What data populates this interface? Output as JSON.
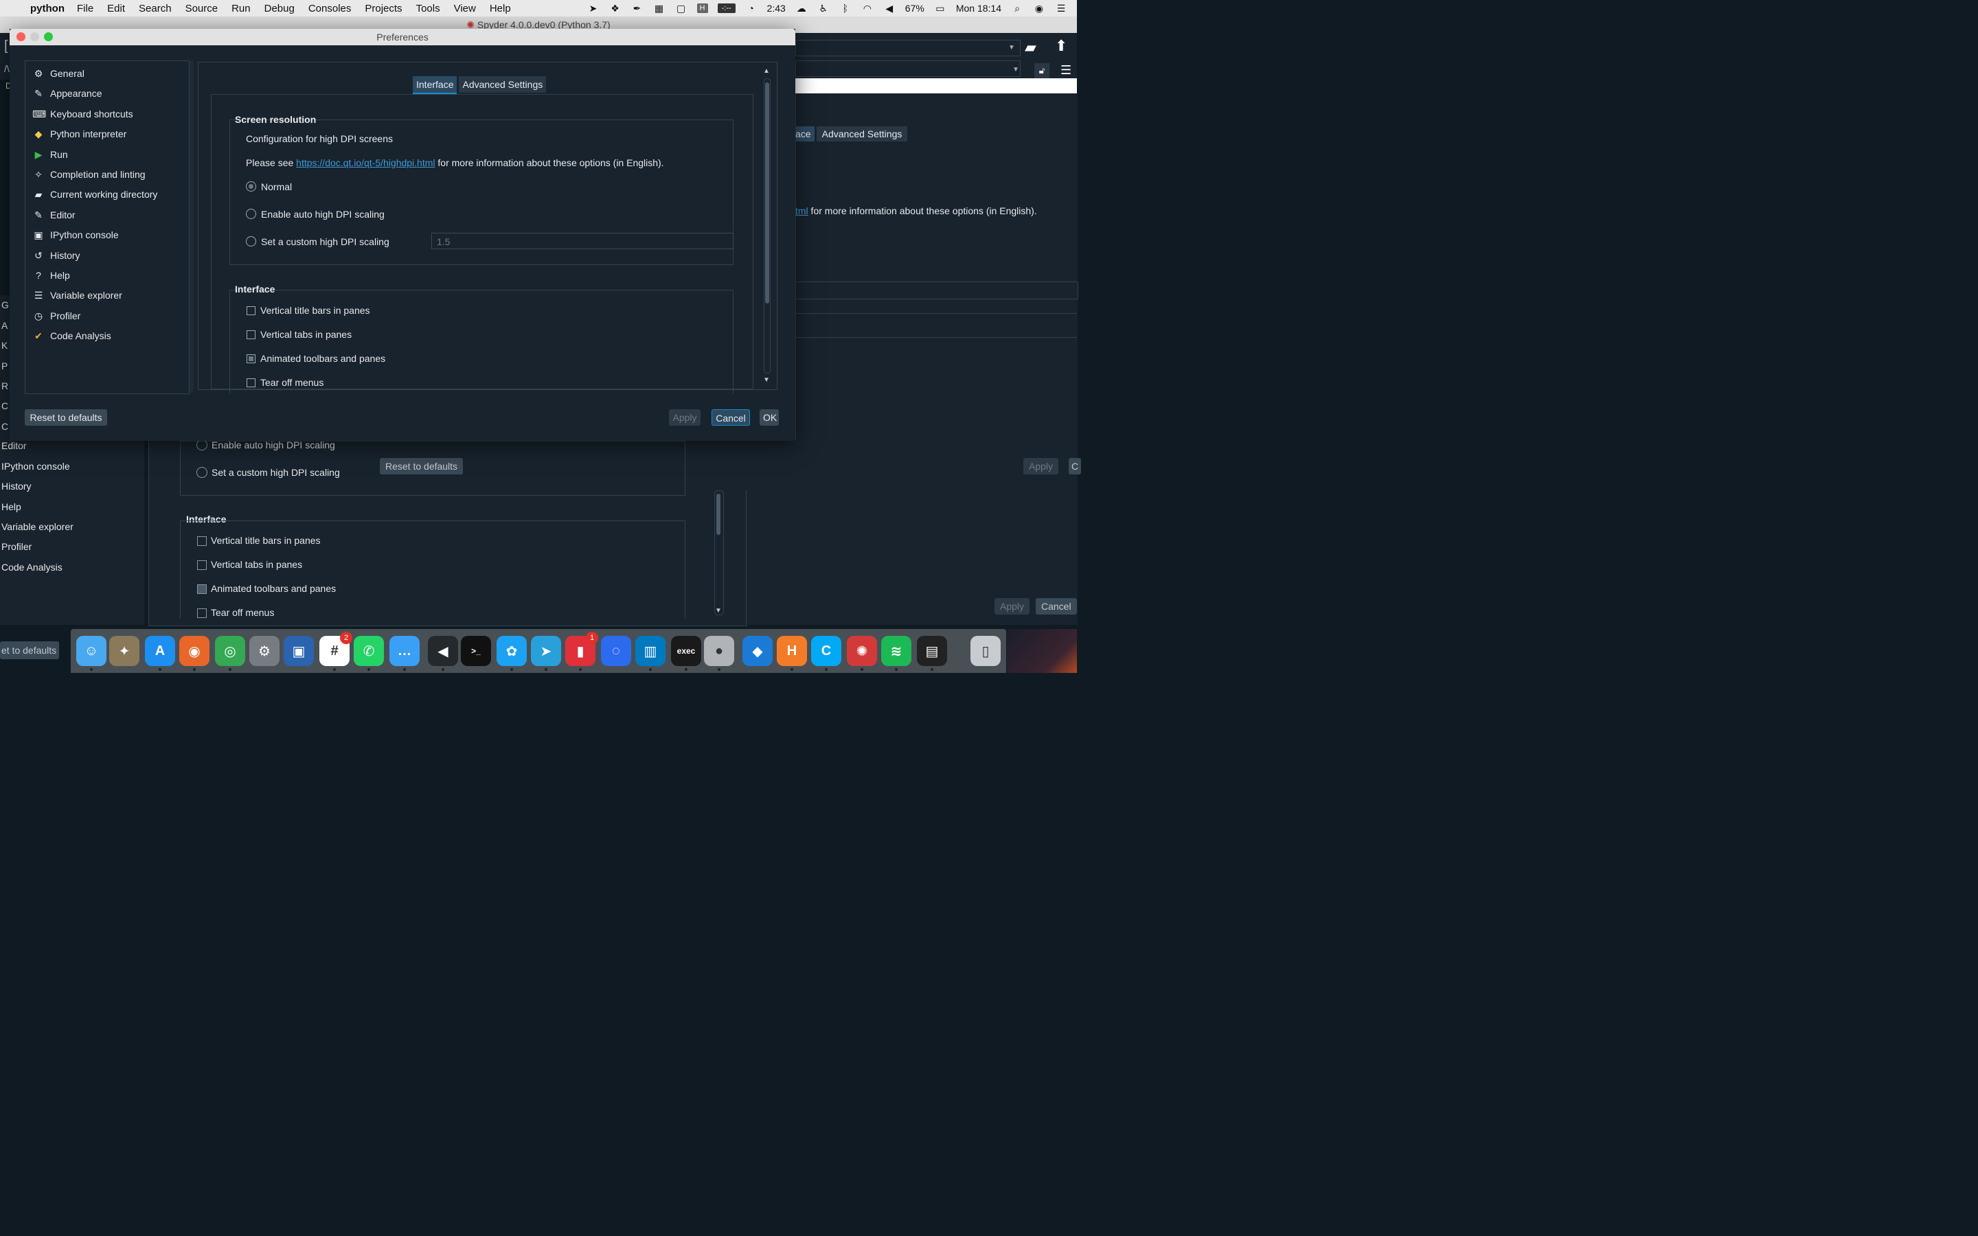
{
  "menubar": {
    "app": "python",
    "items": [
      "File",
      "Edit",
      "Search",
      "Source",
      "Run",
      "Debug",
      "Consoles",
      "Projects",
      "Tools",
      "View",
      "Help"
    ],
    "status": {
      "hbadge": "H",
      "timer": "-:--",
      "clock_label": "2:43",
      "battery": "67%",
      "datetime": "Mon 18:14"
    }
  },
  "background_window": {
    "title": "Spyder 4.0.0.dev0 (Python 3.7)",
    "tab_active_partial": "ace",
    "tab_advanced": "Advanced Settings",
    "info_partial_link": "tml",
    "info_rest": " for more information about these options (in English).",
    "reset_button": "Reset to defaults",
    "apply_button": "Apply",
    "cancel_button": "Cancel",
    "cancel_partial": "C",
    "reset_partial": "et to defaults",
    "left_list_partial": [
      "G",
      "A",
      "K",
      "P",
      "R",
      "C",
      "C"
    ],
    "left_list": [
      "Editor",
      "IPython console",
      "History",
      "Help",
      "Variable explorer",
      "Profiler",
      "Code Analysis"
    ],
    "ghost_auto": "Enable auto high DPI scaling",
    "ghost_custom": "Set a custom high DPI scaling",
    "ghost_interface": "Interface",
    "ghost_checks": [
      "Vertical title bars in panes",
      "Vertical tabs in panes",
      "Animated toolbars and panes",
      "Tear off menus"
    ],
    "ghost_check_states": [
      false,
      false,
      true,
      false
    ],
    "path_partial": "/\\",
    "bracket_partial": "[",
    "d_partial": "D"
  },
  "preferences": {
    "title": "Preferences",
    "nav": [
      {
        "label": "General",
        "icon": "gears-icon",
        "glyph": "⚙"
      },
      {
        "label": "Appearance",
        "icon": "brush-icon",
        "glyph": "✎"
      },
      {
        "label": "Keyboard shortcuts",
        "icon": "keyboard-icon",
        "glyph": "⌨"
      },
      {
        "label": "Python interpreter",
        "icon": "python-icon",
        "glyph": "◆"
      },
      {
        "label": "Run",
        "icon": "play-icon",
        "glyph": "▶"
      },
      {
        "label": "Completion and linting",
        "icon": "completion-icon",
        "glyph": "✧"
      },
      {
        "label": "Current working directory",
        "icon": "folder-open-icon",
        "glyph": "▰"
      },
      {
        "label": "Editor",
        "icon": "edit-icon",
        "glyph": "✎"
      },
      {
        "label": "IPython console",
        "icon": "ipython-icon",
        "glyph": "▣"
      },
      {
        "label": "History",
        "icon": "history-icon",
        "glyph": "↺"
      },
      {
        "label": "Help",
        "icon": "question-icon",
        "glyph": "?"
      },
      {
        "label": "Variable explorer",
        "icon": "table-icon",
        "glyph": "☰"
      },
      {
        "label": "Profiler",
        "icon": "stopwatch-icon",
        "glyph": "◷"
      },
      {
        "label": "Code Analysis",
        "icon": "analysis-icon",
        "glyph": "✔"
      }
    ],
    "tabs": {
      "interface": "Interface",
      "advanced": "Advanced Settings"
    },
    "screen_resolution": {
      "title": "Screen resolution",
      "config_text": "Configuration for high DPI screens",
      "please_see": "Please see ",
      "link": "https://doc.qt.io/qt-5/highdpi.html",
      "more_info": " for more information about these options (in English).",
      "opt_normal": "Normal",
      "opt_auto": "Enable auto high DPI scaling",
      "opt_custom": "Set a custom high DPI scaling",
      "custom_value": "1.5",
      "selected": "Normal"
    },
    "interface": {
      "title": "Interface",
      "checks": [
        {
          "label": "Vertical title bars in panes",
          "checked": false
        },
        {
          "label": "Vertical tabs in panes",
          "checked": false
        },
        {
          "label": "Animated toolbars and panes",
          "checked": true
        },
        {
          "label": "Tear off menus",
          "checked": false
        }
      ]
    },
    "buttons": {
      "reset": "Reset to defaults",
      "apply": "Apply",
      "cancel": "Cancel",
      "ok": "OK"
    }
  },
  "dock": [
    {
      "name": "finder-icon",
      "glyph": "☺",
      "color": "#4aa8f0"
    },
    {
      "name": "preview-icon",
      "glyph": "✦",
      "color": "#8a7a5a"
    },
    {
      "name": "app-store-icon",
      "glyph": "A",
      "color": "#1d8ff0"
    },
    {
      "name": "firefox-icon",
      "glyph": "◉",
      "color": "#e8662a"
    },
    {
      "name": "chrome-icon",
      "glyph": "◎",
      "color": "#34a853"
    },
    {
      "name": "system-preferences-icon",
      "glyph": "⚙",
      "color": "#777c82"
    },
    {
      "name": "virtualbox-icon",
      "glyph": "▣",
      "color": "#2b63b0"
    },
    {
      "name": "slack-icon",
      "glyph": "#",
      "color": "#ffffff",
      "badge": "2"
    },
    {
      "name": "whatsapp-icon",
      "glyph": "✆",
      "color": "#25d366"
    },
    {
      "name": "messages-icon",
      "glyph": "…",
      "color": "#3aa0f5"
    },
    {
      "name": "vscode-icon",
      "glyph": "◀",
      "color": "#24292e"
    },
    {
      "name": "terminal-icon",
      "glyph": ">_",
      "color": "#111111"
    },
    {
      "name": "twitter-icon",
      "glyph": "✿",
      "color": "#1da1f2"
    },
    {
      "name": "telegram-icon",
      "glyph": "➤",
      "color": "#2aa0da"
    },
    {
      "name": "equalizer-icon",
      "glyph": "▮",
      "color": "#e0303a",
      "badge": "1"
    },
    {
      "name": "signal-icon",
      "glyph": "◌",
      "color": "#2c6bed"
    },
    {
      "name": "trello-icon",
      "glyph": "▥",
      "color": "#0079bf"
    },
    {
      "name": "exec-icon",
      "glyph": "exec",
      "color": "#1a1a1a"
    },
    {
      "name": "recorder-icon",
      "glyph": "●",
      "color": "#b0b4b8"
    },
    {
      "name": "vectorize-icon",
      "glyph": "◆",
      "color": "#1b7ad6"
    },
    {
      "name": "h-app-icon",
      "glyph": "H",
      "color": "#f47c28"
    },
    {
      "name": "clockify-icon",
      "glyph": "C",
      "color": "#03a9f4"
    },
    {
      "name": "spider-web-icon",
      "glyph": "✺",
      "color": "#d23a3a"
    },
    {
      "name": "spotify-icon",
      "glyph": "≋",
      "color": "#1db954"
    },
    {
      "name": "screen-icon",
      "glyph": "▤",
      "color": "#222222"
    },
    {
      "name": "trash-icon",
      "glyph": "▯",
      "color": "#c8ccd0"
    }
  ]
}
